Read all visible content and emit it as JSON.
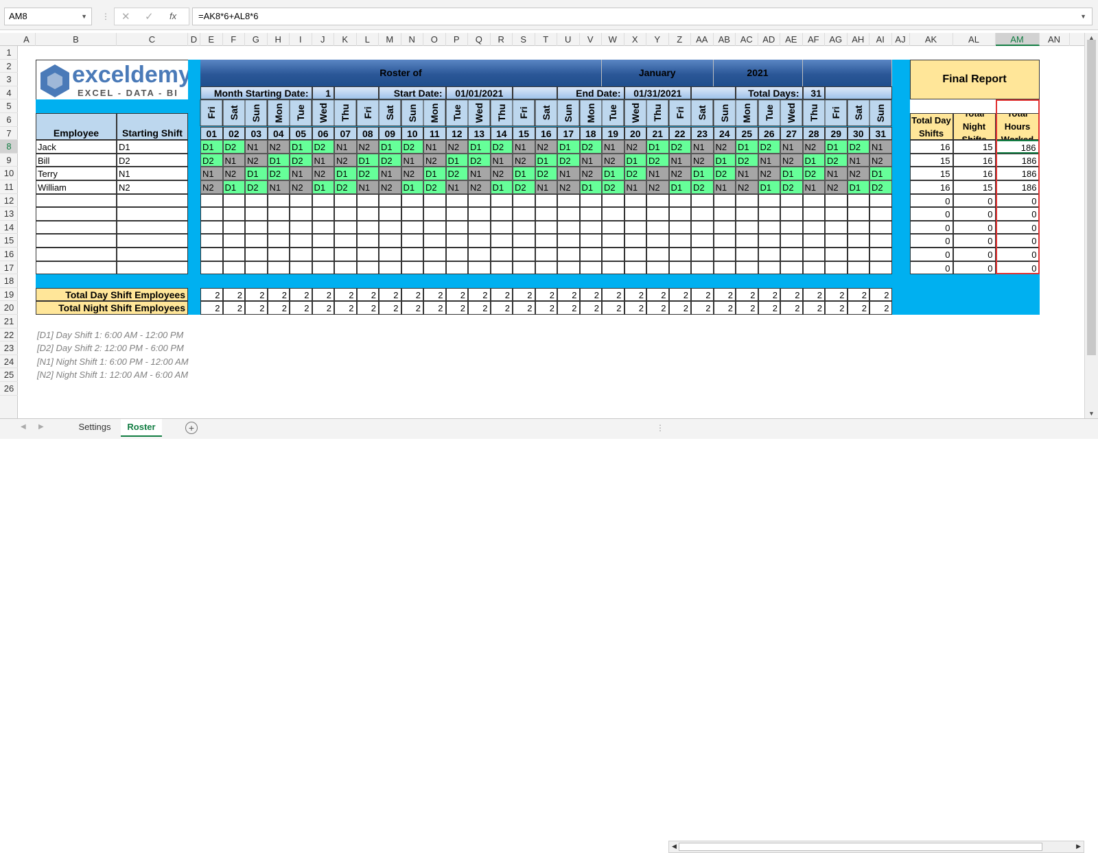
{
  "formula_bar": {
    "name_box": "AM8",
    "formula": "=AK8*6+AL8*6",
    "fx": "fx"
  },
  "columns": [
    "A",
    "B",
    "C",
    "D",
    "E",
    "F",
    "G",
    "H",
    "I",
    "J",
    "K",
    "L",
    "M",
    "N",
    "O",
    "P",
    "Q",
    "R",
    "S",
    "T",
    "U",
    "V",
    "W",
    "X",
    "Y",
    "Z",
    "AA",
    "AB",
    "AC",
    "AD",
    "AE",
    "AF",
    "AG",
    "AH",
    "AI",
    "AJ",
    "AK",
    "AL",
    "AM",
    "AN"
  ],
  "rows": [
    1,
    2,
    3,
    4,
    5,
    6,
    7,
    8,
    9,
    10,
    11,
    12,
    13,
    14,
    15,
    16,
    17,
    18,
    19,
    20,
    21,
    22,
    23,
    24,
    25,
    26
  ],
  "selected_cell": {
    "column": "AM",
    "row": 8
  },
  "logo": {
    "brand": "exceldemy",
    "tagline": "EXCEL - DATA - BI"
  },
  "roster": {
    "title": "Roster of",
    "month": "January",
    "year": "2021",
    "month_start_label": "Month Starting Date:",
    "month_start_value": "1",
    "start_label": "Start Date:",
    "start_value": "01/01/2021",
    "end_label": "End Date:",
    "end_value": "01/31/2021",
    "total_days_label": "Total Days:",
    "total_days_value": "31"
  },
  "table_headers": {
    "employee": "Employee",
    "starting_shift": "Starting Shift"
  },
  "days": [
    "Fri",
    "Sat",
    "Sun",
    "Mon",
    "Tue",
    "Wed",
    "Thu",
    "Fri",
    "Sat",
    "Sun",
    "Mon",
    "Tue",
    "Wed",
    "Thu",
    "Fri",
    "Sat",
    "Sun",
    "Mon",
    "Tue",
    "Wed",
    "Thu",
    "Fri",
    "Sat",
    "Sun",
    "Mon",
    "Tue",
    "Wed",
    "Thu",
    "Fri",
    "Sat",
    "Sun"
  ],
  "dates": [
    "01",
    "02",
    "03",
    "04",
    "05",
    "06",
    "07",
    "08",
    "09",
    "10",
    "11",
    "12",
    "13",
    "14",
    "15",
    "16",
    "17",
    "18",
    "19",
    "20",
    "21",
    "22",
    "23",
    "24",
    "25",
    "26",
    "27",
    "28",
    "29",
    "30",
    "31"
  ],
  "employees": [
    {
      "name": "Jack",
      "shift": "D1",
      "schedule": [
        "D1",
        "D2",
        "N1",
        "N2",
        "D1",
        "D2",
        "N1",
        "N2",
        "D1",
        "D2",
        "N1",
        "N2",
        "D1",
        "D2",
        "N1",
        "N2",
        "D1",
        "D2",
        "N1",
        "N2",
        "D1",
        "D2",
        "N1",
        "N2",
        "D1",
        "D2",
        "N1",
        "N2",
        "D1",
        "D2",
        "N1"
      ]
    },
    {
      "name": "Bill",
      "shift": "D2",
      "schedule": [
        "D2",
        "N1",
        "N2",
        "D1",
        "D2",
        "N1",
        "N2",
        "D1",
        "D2",
        "N1",
        "N2",
        "D1",
        "D2",
        "N1",
        "N2",
        "D1",
        "D2",
        "N1",
        "N2",
        "D1",
        "D2",
        "N1",
        "N2",
        "D1",
        "D2",
        "N1",
        "N2",
        "D1",
        "D2",
        "N1",
        "N2"
      ]
    },
    {
      "name": "Terry",
      "shift": "N1",
      "schedule": [
        "N1",
        "N2",
        "D1",
        "D2",
        "N1",
        "N2",
        "D1",
        "D2",
        "N1",
        "N2",
        "D1",
        "D2",
        "N1",
        "N2",
        "D1",
        "D2",
        "N1",
        "N2",
        "D1",
        "D2",
        "N1",
        "N2",
        "D1",
        "D2",
        "N1",
        "N2",
        "D1",
        "D2",
        "N1",
        "N2",
        "D1"
      ]
    },
    {
      "name": "William",
      "shift": "N2",
      "schedule": [
        "N2",
        "D1",
        "D2",
        "N1",
        "N2",
        "D1",
        "D2",
        "N1",
        "N2",
        "D1",
        "D2",
        "N1",
        "N2",
        "D1",
        "D2",
        "N1",
        "N2",
        "D1",
        "D2",
        "N1",
        "N2",
        "D1",
        "D2",
        "N1",
        "N2",
        "D1",
        "D2",
        "N1",
        "N2",
        "D1",
        "D2"
      ]
    }
  ],
  "totals": {
    "day_label": "Total Day Shift Employees",
    "night_label": "Total Night Shift Employees",
    "day_values": [
      "2",
      "2",
      "2",
      "2",
      "2",
      "2",
      "2",
      "2",
      "2",
      "2",
      "2",
      "2",
      "2",
      "2",
      "2",
      "2",
      "2",
      "2",
      "2",
      "2",
      "2",
      "2",
      "2",
      "2",
      "2",
      "2",
      "2",
      "2",
      "2",
      "2",
      "2"
    ],
    "night_values": [
      "2",
      "2",
      "2",
      "2",
      "2",
      "2",
      "2",
      "2",
      "2",
      "2",
      "2",
      "2",
      "2",
      "2",
      "2",
      "2",
      "2",
      "2",
      "2",
      "2",
      "2",
      "2",
      "2",
      "2",
      "2",
      "2",
      "2",
      "2",
      "2",
      "2",
      "2"
    ]
  },
  "final_report": {
    "title": "Final Report",
    "headers": [
      "Total Day Shifts",
      "Total Night Shifts",
      "Total Hours Worked"
    ],
    "rows": [
      [
        "16",
        "15",
        "186"
      ],
      [
        "15",
        "16",
        "186"
      ],
      [
        "15",
        "16",
        "186"
      ],
      [
        "16",
        "15",
        "186"
      ],
      [
        "0",
        "0",
        "0"
      ],
      [
        "0",
        "0",
        "0"
      ],
      [
        "0",
        "0",
        "0"
      ],
      [
        "0",
        "0",
        "0"
      ],
      [
        "0",
        "0",
        "0"
      ],
      [
        "0",
        "0",
        "0"
      ]
    ]
  },
  "notes": [
    "[D1] Day Shift 1: 6:00 AM - 12:00 PM",
    "[D2] Day Shift 2: 12:00 PM - 6:00 PM",
    "[N1] Night Shift 1: 6:00 PM - 12:00 AM",
    "[N2] Night Shift 1: 12:00 AM - 6:00 AM"
  ],
  "sheet_tabs": [
    "Settings",
    "Roster"
  ],
  "active_tab": "Roster",
  "colors": {
    "green": "#66ff99",
    "gray": "#a6a6a6",
    "blue": "#00b0f0",
    "yellow": "#ffe699",
    "accent": "#107c41"
  }
}
